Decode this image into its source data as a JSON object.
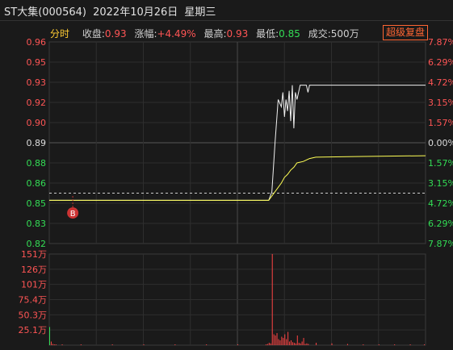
{
  "header": {
    "name": "ST大集(000564)",
    "date": "2022年10月26日",
    "weekday": "星期三"
  },
  "info_bar": {
    "tab": "分时",
    "close_label": "收盘:",
    "close_value": "0.93",
    "change_label": "涨幅:",
    "change_value": "+4.49%",
    "high_label": "最高:",
    "high_value": "0.93",
    "low_label": "最低:",
    "low_value": "0.85",
    "volume_label": "成交:",
    "volume_value": "500万",
    "upgrade_button": "超级复盘"
  },
  "colors": {
    "up": "#ff5555",
    "down": "#33dd55",
    "neutral": "#dddddd",
    "price_line": "#f0f0f0",
    "avg_line": "#ffff55",
    "volume_bar": "#ff4444",
    "marker": "#cc3333"
  },
  "chart_data": {
    "type": "line",
    "subtype": "intraday_time_share",
    "prev_close": 0.89,
    "ylim": [
      0.82,
      0.96
    ],
    "y_ticks_left": [
      "0.96",
      "0.95",
      "0.93",
      "0.92",
      "0.90",
      "0.89",
      "0.88",
      "0.86",
      "0.85",
      "0.83",
      "0.82"
    ],
    "y_ticks_right": [
      "7.87%",
      "6.29%",
      "4.72%",
      "3.15%",
      "1.57%",
      "0.00%",
      "1.57%",
      "3.15%",
      "4.72%",
      "6.29%",
      "7.87%"
    ],
    "grid": true,
    "series": [
      {
        "name": "price",
        "points": [
          [
            0,
            0.85
          ],
          [
            120,
            0.85
          ],
          [
            140,
            0.85
          ],
          [
            142,
            0.856
          ],
          [
            144,
            0.89
          ],
          [
            146,
            0.92
          ],
          [
            148,
            0.915
          ],
          [
            149,
            0.925
          ],
          [
            150,
            0.908
          ],
          [
            151,
            0.92
          ],
          [
            152,
            0.912
          ],
          [
            153,
            0.926
          ],
          [
            154,
            0.905
          ],
          [
            155,
            0.93
          ],
          [
            156,
            0.9
          ],
          [
            157,
            0.925
          ],
          [
            158,
            0.92
          ],
          [
            160,
            0.93
          ],
          [
            162,
            0.93
          ],
          [
            164,
            0.93
          ],
          [
            165,
            0.925
          ],
          [
            166,
            0.93
          ],
          [
            168,
            0.93
          ],
          [
            240,
            0.93
          ]
        ]
      },
      {
        "name": "average",
        "points": [
          [
            0,
            0.85
          ],
          [
            120,
            0.85
          ],
          [
            140,
            0.85
          ],
          [
            144,
            0.856
          ],
          [
            148,
            0.862
          ],
          [
            150,
            0.866
          ],
          [
            152,
            0.868
          ],
          [
            154,
            0.871
          ],
          [
            156,
            0.873
          ],
          [
            158,
            0.876
          ],
          [
            162,
            0.877
          ],
          [
            166,
            0.879
          ],
          [
            170,
            0.88
          ],
          [
            200,
            0.8805
          ],
          [
            240,
            0.881
          ]
        ]
      }
    ],
    "reference_line": 0.855,
    "marker": {
      "label": "B",
      "x": 15,
      "price": 0.853
    },
    "volume": {
      "unit": "万",
      "y_ticks": [
        "151万",
        "126万",
        "101万",
        "75.4万",
        "50.3万",
        "25.1万"
      ],
      "ylim": [
        0,
        151
      ],
      "bars": [
        [
          0,
          30
        ],
        [
          1,
          6
        ],
        [
          2,
          2
        ],
        [
          3,
          1
        ],
        [
          4,
          1
        ],
        [
          8,
          1
        ],
        [
          20,
          1
        ],
        [
          40,
          1
        ],
        [
          60,
          1
        ],
        [
          80,
          1
        ],
        [
          100,
          1
        ],
        [
          120,
          1
        ],
        [
          138,
          1
        ],
        [
          139,
          2
        ],
        [
          140,
          4
        ],
        [
          141,
          3
        ],
        [
          142,
          151
        ],
        [
          143,
          18
        ],
        [
          144,
          16
        ],
        [
          145,
          20
        ],
        [
          146,
          10
        ],
        [
          147,
          8
        ],
        [
          148,
          14
        ],
        [
          149,
          12
        ],
        [
          150,
          18
        ],
        [
          151,
          10
        ],
        [
          152,
          22
        ],
        [
          153,
          6
        ],
        [
          154,
          8
        ],
        [
          155,
          5
        ],
        [
          156,
          4
        ],
        [
          157,
          3
        ],
        [
          158,
          16
        ],
        [
          159,
          4
        ],
        [
          160,
          3
        ],
        [
          161,
          6
        ],
        [
          162,
          12
        ],
        [
          163,
          2
        ],
        [
          164,
          3
        ],
        [
          165,
          2
        ],
        [
          170,
          4
        ],
        [
          180,
          3
        ],
        [
          190,
          2
        ],
        [
          200,
          1
        ],
        [
          210,
          1
        ],
        [
          220,
          1
        ],
        [
          230,
          1
        ],
        [
          239,
          1
        ]
      ]
    }
  }
}
